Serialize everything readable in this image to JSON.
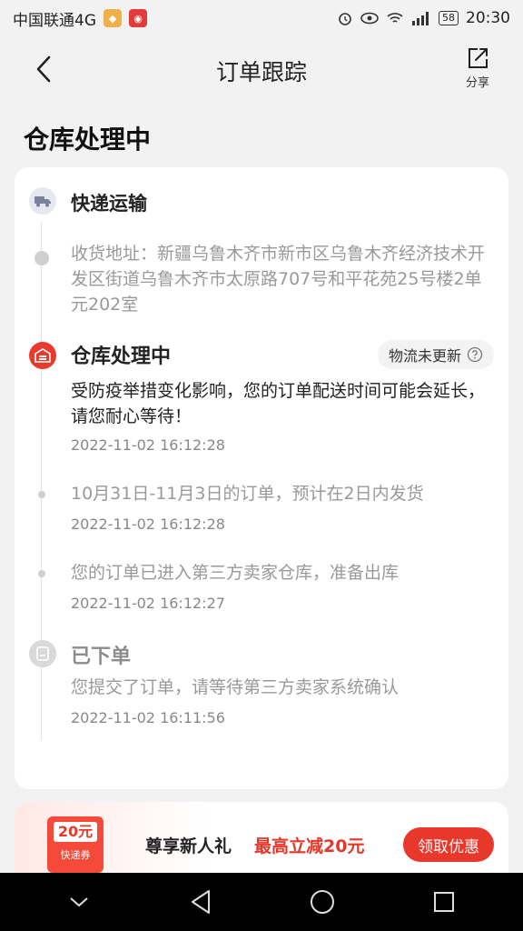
{
  "status_bar": {
    "carrier": "中国联通4G",
    "battery": "58",
    "time": "20:30"
  },
  "header": {
    "title": "订单跟踪",
    "share_label": "分享"
  },
  "status_heading": "仓库处理中",
  "timeline": {
    "transport": {
      "title": "快递运输"
    },
    "address": "收货地址：新疆乌鲁木齐市新市区乌鲁木齐经济技术开发区街道乌鲁木齐市太原路707号和平花苑25号楼2单元202室",
    "current": {
      "title": "仓库处理中",
      "pill": "物流未更新",
      "text": "受防疫举措变化影响，您的订单配送时间可能会延长，请您耐心等待！",
      "time": "2022-11-02 16:12:28"
    },
    "event2": {
      "text": "10月31日-11月3日的订单，预计在2日内发货",
      "time": "2022-11-02 16:12:28"
    },
    "event3": {
      "text": "您的订单已进入第三方卖家仓库，准备出库",
      "time": "2022-11-02 16:12:27"
    },
    "ordered": {
      "title": "已下单",
      "text": "您提交了订单，请等待第三方卖家系统确认",
      "time": "2022-11-02 16:11:56"
    }
  },
  "promo": {
    "coupon_amount": "20元",
    "coupon_label": "快递券",
    "text": "尊享新人礼",
    "highlight": "最高立减20元",
    "button": "领取优惠"
  },
  "colors": {
    "accent": "#e8372b",
    "timeline_gray": "#cfcfcf"
  },
  "icons": [
    "back-arrow-icon",
    "share-icon",
    "truck-icon",
    "warehouse-icon",
    "order-icon",
    "help-circle-icon"
  ]
}
